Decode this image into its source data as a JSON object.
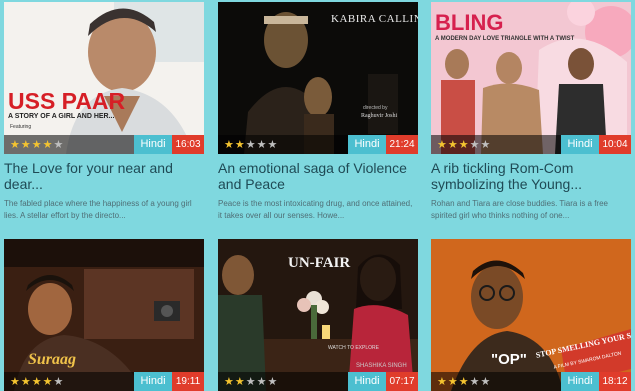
{
  "cards": [
    {
      "poster": {
        "headline": "USS PAAR",
        "tagline": "A STORY OF A GIRL AND HER...",
        "credit": "Featuring"
      },
      "rating": 4,
      "language": "Hindi",
      "duration": "16:03",
      "title": "The Love for your near and dear...",
      "description": "The fabled place where the happiness of a young girl lies. A stellar effort by the directo..."
    },
    {
      "poster": {
        "headline": "KABIRA CALLING",
        "credit": "directed by",
        "credit_name": "Raghuvir Joshi"
      },
      "rating": 2,
      "language": "Hindi",
      "duration": "21:24",
      "title": "An emotional saga of Violence and Peace",
      "description": "Peace is the most intoxicating drug, and once attained, it takes over all our senses. Howe..."
    },
    {
      "poster": {
        "headline": "BLING",
        "tagline": "A MODERN DAY LOVE TRIANGLE WITH A TWIST"
      },
      "rating": 3,
      "language": "Hindi",
      "duration": "10:04",
      "title": "A rib tickling Rom-Com symbolizing the Young...",
      "description": "Rohan and Tiara are close buddies. Tiara is a free spirited girl who thinks nothing of one..."
    },
    {
      "poster": {
        "headline": "Suraag"
      },
      "rating": 4,
      "language": "Hindi",
      "duration": "19:11"
    },
    {
      "poster": {
        "headline": "UN-FAIR",
        "tagline": "WATCH TO EXPLORE",
        "credit_name": "SHASHIKA SINGH"
      },
      "rating": 2,
      "language": "Hindi",
      "duration": "07:17"
    },
    {
      "poster": {
        "headline": "\"OP\"",
        "tagline": "STOP SMELLING YOUR SOCKS",
        "credit": "A FILM BY SWAROM DALTON"
      },
      "rating": 3,
      "language": "Hindi",
      "duration": "18:12"
    }
  ],
  "icons": {
    "star": "star-icon"
  },
  "colors": {
    "background": "#7fd8df",
    "language_badge": "#4cbfd0",
    "duration_badge": "#e03c2b",
    "star_on": "#f4c430",
    "title_text": "#1f4a55"
  }
}
